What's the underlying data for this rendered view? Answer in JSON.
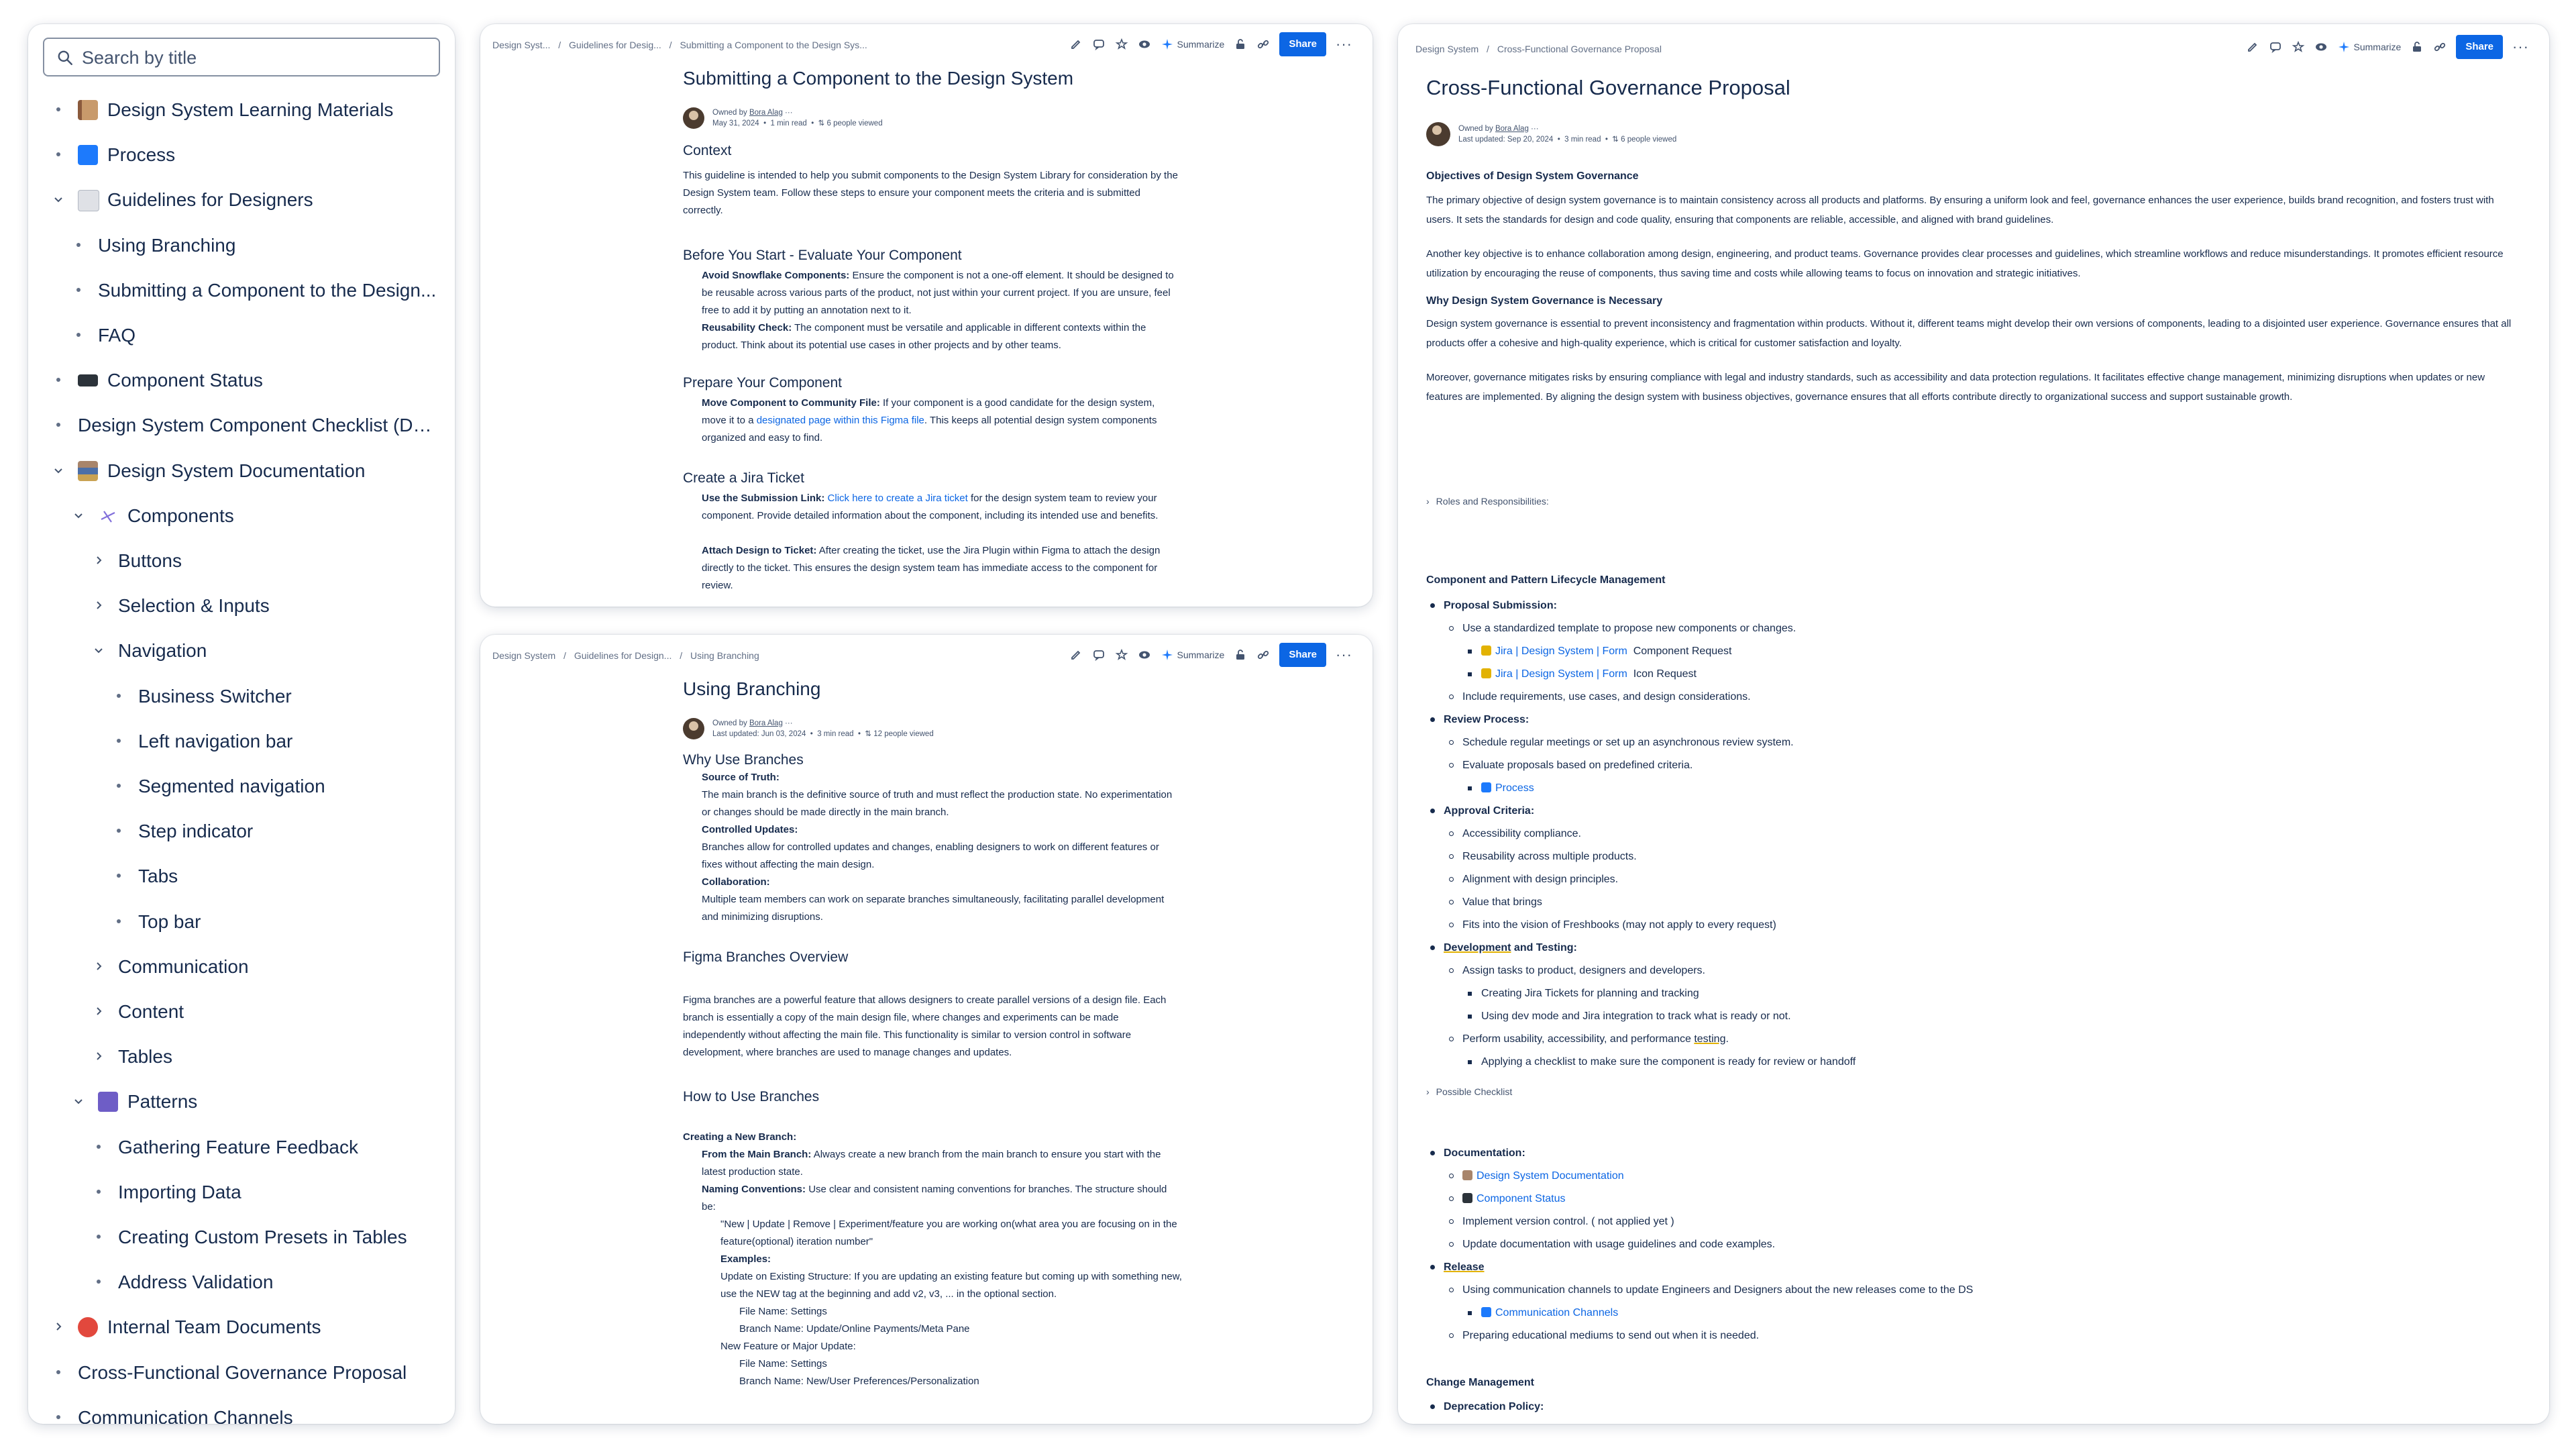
{
  "sidebar": {
    "search_placeholder": "Search by title",
    "items": [
      {
        "label": "Design System Learning Materials"
      },
      {
        "label": "Process"
      },
      {
        "label": "Guidelines for Designers"
      },
      {
        "label": "Using Branching"
      },
      {
        "label": "Submitting a Component to the Design..."
      },
      {
        "label": "FAQ"
      },
      {
        "label": "Component Status"
      },
      {
        "label": "Design System Component Checklist (De..."
      },
      {
        "label": "Design System Documentation"
      },
      {
        "label": "Components"
      },
      {
        "label": "Buttons"
      },
      {
        "label": "Selection & Inputs"
      },
      {
        "label": "Navigation"
      },
      {
        "label": "Business Switcher"
      },
      {
        "label": "Left navigation bar"
      },
      {
        "label": "Segmented navigation"
      },
      {
        "label": "Step indicator"
      },
      {
        "label": "Tabs"
      },
      {
        "label": "Top bar"
      },
      {
        "label": "Communication"
      },
      {
        "label": "Content"
      },
      {
        "label": "Tables"
      },
      {
        "label": "Patterns"
      },
      {
        "label": "Gathering Feature Feedback"
      },
      {
        "label": "Importing Data"
      },
      {
        "label": "Creating Custom Presets in Tables"
      },
      {
        "label": "Address Validation"
      },
      {
        "label": "Internal Team Documents"
      },
      {
        "label": "Cross-Functional Governance Proposal"
      },
      {
        "label": "Communication Channels"
      }
    ]
  },
  "toolbar": {
    "summarize": "Summarize",
    "share": "Share"
  },
  "doc1": {
    "breadcrumb": [
      "Design Syst...",
      "Guidelines for Desig...",
      "Submitting a Component to the Design Sys..."
    ],
    "title": "Submitting a Component to the Design System",
    "owned_by": "Owned by",
    "owner": "Bora Alag",
    "date": "May 31, 2024",
    "read": "1 min read",
    "viewed": "6 people viewed",
    "context_h": "Context",
    "context_p": "This guideline is intended to help you submit components to the Design System Library for consideration by the Design System team. Follow these steps to ensure your component meets the criteria and is submitted correctly.",
    "before_h": "Before You Start - Evaluate Your Component",
    "avoid_b": "Avoid Snowflake Components:",
    "avoid_t": "Ensure the component is not a one-off element. It should be designed to be reusable across various parts of the product, not just within your current project. If you are unsure, feel free to add it by putting an annotation next to it.",
    "reuse_b": "Reusability Check:",
    "reuse_t": "The component must be versatile and applicable in different contexts within the product. Think about its potential use cases in other projects and by other teams.",
    "prepare_h": "Prepare Your Component",
    "move_b": "Move Component to Community File:",
    "move_t1": "If your component is a good candidate for the design system, move it to a",
    "move_link": "designated page within this Figma file",
    "move_t2": ". This keeps all potential design system components organized and easy to find.",
    "jira_h": "Create a Jira Ticket",
    "sub_b": "Use the Submission Link:",
    "sub_link": "Click here to create a Jira ticket",
    "sub_t": "for the design system team to review your component. Provide detailed information about the component, including its intended use and benefits.",
    "attach_b": "Attach Design to Ticket:",
    "attach_t": "After creating the ticket, use the Jira Plugin within Figma to attach the design directly to the ticket. This ensures the design system team has immediate access to the component for review."
  },
  "doc2": {
    "breadcrumb": [
      "Design System",
      "Guidelines for Design...",
      "Using Branching"
    ],
    "title": "Using Branching",
    "owned_by": "Owned by",
    "owner": "Bora Alag",
    "date": "Last updated: Jun 03, 2024",
    "read": "3 min read",
    "viewed": "12 people viewed",
    "why_h": "Why Use Branches",
    "sot_b": "Source of Truth:",
    "sot_t": "The main branch is the definitive source of truth and must reflect the production state. No experimentation or changes should be made directly in the main branch.",
    "cu_b": "Controlled Updates:",
    "cu_t": "Branches allow for controlled updates and changes, enabling designers to work on different features or fixes without affecting the main design.",
    "col_b": "Collaboration:",
    "col_t": "Multiple team members can work on separate branches simultaneously, facilitating parallel development and minimizing disruptions.",
    "fbo_h": "Figma Branches Overview",
    "fbo_p": "Figma branches are a powerful feature that allows designers to create parallel versions of a design file. Each branch is essentially a copy of the main design file, where changes and experiments can be made independently without affecting the main file. This functionality is similar to version control in software development, where branches are used to manage changes and updates.",
    "how_h": "How to Use Branches",
    "cnb_b": "Creating a New Branch:",
    "ftm_b": "From the Main Branch:",
    "ftm_t": "Always create a new branch from the main branch to ensure you start with the latest production state.",
    "nc_b": "Naming Conventions:",
    "nc_t": "Use clear and consistent naming conventions for branches. The structure should be:",
    "pattern": "\"New | Update | Remove | Experiment/feature you are working on(what area you are focusing on in the feature(optional) iteration number\"",
    "ex_b": "Examples:",
    "ex1": "Update on Existing Structure: If you are updating an existing feature but coming up with something new, use the NEW tag at the beginning and add v2, v3, ... in the optional section.",
    "ex1_fn": "File Name: Settings",
    "ex1_bn": "Branch Name: Update/Online Payments/Meta Pane",
    "ex2": "New Feature or Major Update:",
    "ex2_fn": "File Name: Settings",
    "ex2_bn": "Branch Name: New/User Preferences/Personalization"
  },
  "doc3": {
    "breadcrumb": [
      "Design System",
      "Cross-Functional Governance Proposal"
    ],
    "title": "Cross-Functional Governance Proposal",
    "owned_by": "Owned by",
    "owner": "Bora Alag",
    "date": "Last updated: Sep 20, 2024",
    "read": "3 min read",
    "viewed": "6 people viewed",
    "obj_h": "Objectives of Design System Governance",
    "obj_p1": "The primary objective of design system governance is to maintain consistency across all products and platforms. By ensuring a uniform look and feel, governance enhances the user experience, builds brand recognition, and fosters trust with users. It sets the standards for design and code quality, ensuring that components are reliable, accessible, and aligned with brand guidelines.",
    "obj_p2": "Another key objective is to enhance collaboration among design, engineering, and product teams. Governance provides clear processes and guidelines, which streamline workflows and reduce misunderstandings. It promotes efficient resource utilization by encouraging the reuse of components, thus saving time and costs while allowing teams to focus on innovation and strategic initiatives.",
    "why_h": "Why Design System Governance is Necessary",
    "why_p1": "Design system governance is essential to prevent inconsistency and fragmentation within products. Without it, different teams might develop their own versions of components, leading to a disjointed user experience. Governance ensures that all products offer a cohesive and high-quality experience, which is critical for customer satisfaction and loyalty.",
    "why_p2": "Moreover, governance mitigates risks by ensuring compliance with legal and industry standards, such as accessibility and data protection regulations. It facilitates effective change management, minimizing disruptions when updates or new features are implemented. By aligning the design system with business objectives, governance ensures that all efforts contribute directly to organizational success and support sustainable growth.",
    "roles": "Roles and Responsibilities:",
    "lifecycle_h": "Component and Pattern Lifecycle Management",
    "ps_b": "Proposal Submission:",
    "ps_1": "Use a standardized template to propose new components or changes.",
    "ps_l1a": "Jira | Design System",
    "ps_l1b": "| Form",
    "ps_l1c": "Component Request",
    "ps_l2a": "Jira | Design System",
    "ps_l2b": "| Form",
    "ps_l2c": "Icon Request",
    "ps_2": "Include requirements, use cases, and design considerations.",
    "rp_b": "Review Process:",
    "rp_1": "Schedule regular meetings or set up an asynchronous review system.",
    "rp_2": "Evaluate proposals based on predefined criteria.",
    "rp_link": "Process",
    "ac_b": "Approval Criteria:",
    "ac_1": "Accessibility compliance.",
    "ac_2": "Reusability across multiple products.",
    "ac_3": "Alignment with design principles.",
    "ac_4": "Value that brings",
    "ac_5": "Fits into the vision of Freshbooks (may not apply to every request)",
    "dt_b1": "Development",
    "dt_b2": " and Testing:",
    "dt_1": "Assign tasks to product, designers and developers.",
    "dt_1a": "Creating Jira Tickets for planning and tracking",
    "dt_1b": "Using dev mode and Jira integration to track what is ready or not.",
    "dt_2a": "Perform usability, accessibility, and performance ",
    "dt_2b": "testing",
    "dt_2c": ".",
    "dt_2x": "Applying a checklist to make sure the component is ready for review or handoff",
    "possible": "Possible Checklist",
    "doc_b": "Documentation:",
    "doc_l1": "Design System Documentation",
    "doc_l2": "Component Status",
    "doc_3": "Implement version control. ( not applied yet )",
    "doc_4": "Update documentation with usage guidelines and code examples.",
    "rel_b": "Release",
    "rel_1": "Using communication channels to update Engineers and Designers about the new releases come to the DS",
    "rel_link": "Communication Channels",
    "rel_2": "Preparing educational mediums to send out when it is needed.",
    "cm_h": "Change Management",
    "dp_b": "Deprecation Policy:"
  },
  "colors": {
    "accent": "#0c66e4",
    "text": "#172b4d",
    "muted": "#626f86"
  }
}
